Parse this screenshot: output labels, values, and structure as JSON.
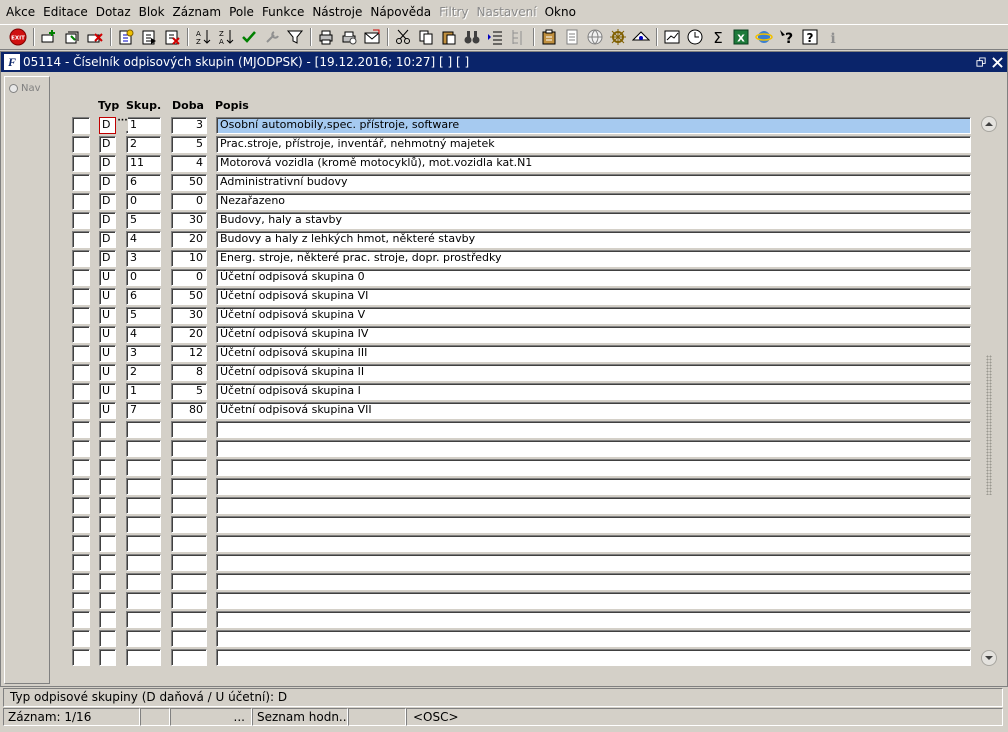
{
  "menu": [
    "Akce",
    "Editace",
    "Dotaz",
    "Blok",
    "Záznam",
    "Pole",
    "Funkce",
    "Nástroje",
    "Nápověda",
    "Filtry",
    "Nastavení",
    "Okno"
  ],
  "menu_disabled": [
    false,
    false,
    false,
    false,
    false,
    false,
    false,
    false,
    false,
    true,
    true,
    false
  ],
  "toolbar": {
    "exit_label": "EXIT",
    "help_glyph": "?",
    "info_glyph": "i",
    "sigma_glyph": "Σ",
    "excel_glyph": "X"
  },
  "window": {
    "icon_glyph": "F",
    "title": "05114 - Číselník odpisových skupin (MJODPSK) - [19.12.2016; 10:27] [ ] [ ]"
  },
  "nav": {
    "label": "Nav"
  },
  "columns": {
    "typ": "Typ",
    "skup": "Skup.",
    "doba": "Doba",
    "popis": "Popis"
  },
  "lov_glyph": "···",
  "rows": [
    {
      "typ": "D",
      "skup": "1",
      "doba": "3",
      "popis": "Osobní automobily,spec. přístroje, software"
    },
    {
      "typ": "D",
      "skup": "2",
      "doba": "5",
      "popis": "Prac.stroje, přístroje, inventář, nehmotný majetek"
    },
    {
      "typ": "D",
      "skup": "11",
      "doba": "4",
      "popis": "Motorová vozidla (kromě motocyklů), mot.vozidla kat.N1"
    },
    {
      "typ": "D",
      "skup": "6",
      "doba": "50",
      "popis": "Administrativní budovy"
    },
    {
      "typ": "D",
      "skup": "0",
      "doba": "0",
      "popis": "Nezařazeno"
    },
    {
      "typ": "D",
      "skup": "5",
      "doba": "30",
      "popis": "Budovy, haly a stavby"
    },
    {
      "typ": "D",
      "skup": "4",
      "doba": "20",
      "popis": "Budovy a haly z lehkých hmot, některé stavby"
    },
    {
      "typ": "D",
      "skup": "3",
      "doba": "10",
      "popis": "Energ. stroje, některé prac. stroje, dopr. prostředky"
    },
    {
      "typ": "U",
      "skup": "0",
      "doba": "0",
      "popis": "Účetní odpisová skupina 0"
    },
    {
      "typ": "U",
      "skup": "6",
      "doba": "50",
      "popis": "Účetní odpisová skupina VI"
    },
    {
      "typ": "U",
      "skup": "5",
      "doba": "30",
      "popis": "Účetní odpisová skupina V"
    },
    {
      "typ": "U",
      "skup": "4",
      "doba": "20",
      "popis": "Účetní odpisová skupina IV"
    },
    {
      "typ": "U",
      "skup": "3",
      "doba": "12",
      "popis": "Účetní odpisová skupina III"
    },
    {
      "typ": "U",
      "skup": "2",
      "doba": "8",
      "popis": "Účetní odpisová skupina II"
    },
    {
      "typ": "U",
      "skup": "1",
      "doba": "5",
      "popis": "Účetní odpisová skupina I"
    },
    {
      "typ": "U",
      "skup": "7",
      "doba": "80",
      "popis": "Účetní odpisová skupina VII"
    }
  ],
  "hint": "Typ odpisové skupiny (D daňová / U účetní): D",
  "status": {
    "record": "Záznam: 1/16",
    "field2": "",
    "field3": "...",
    "list": "Seznam hodn...",
    "field5": "",
    "mode": "<OSC>"
  }
}
